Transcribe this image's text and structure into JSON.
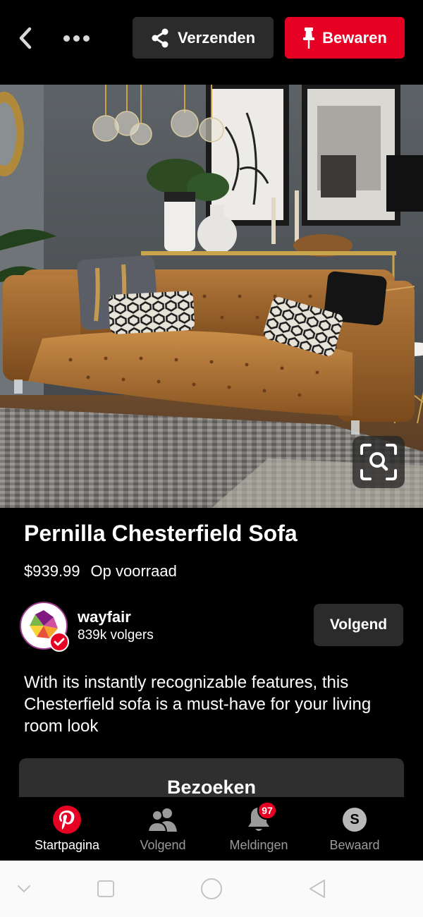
{
  "topbar": {
    "back_icon": "chevron-left-icon",
    "more_icon": "more-horizontal-icon",
    "send_label": "Verzenden",
    "save_label": "Bewaren"
  },
  "pin": {
    "image_subject": "sofa-photo",
    "title": "Pernilla Chesterfield Sofa",
    "price": "$939.99",
    "stock": "Op voorraad",
    "description": "With its instantly recognizable features, this Chesterfield sofa is a must-have for your living room look"
  },
  "creator": {
    "name": "wayfair",
    "followers": "839k volgers",
    "follow_label": "Volgend"
  },
  "visit_label": "Bezoeken",
  "bottom_nav": {
    "items": [
      {
        "label": "Startpagina",
        "icon": "pinterest-logo-icon",
        "active": true
      },
      {
        "label": "Volgend",
        "icon": "people-icon"
      },
      {
        "label": "Meldingen",
        "icon": "bell-icon",
        "badge": "97"
      },
      {
        "label": "Bewaard",
        "icon": "profile-icon",
        "initial": "S"
      }
    ]
  },
  "colors": {
    "brand_red": "#e60023",
    "background": "#000000",
    "button_dark": "#2b2b2b"
  }
}
